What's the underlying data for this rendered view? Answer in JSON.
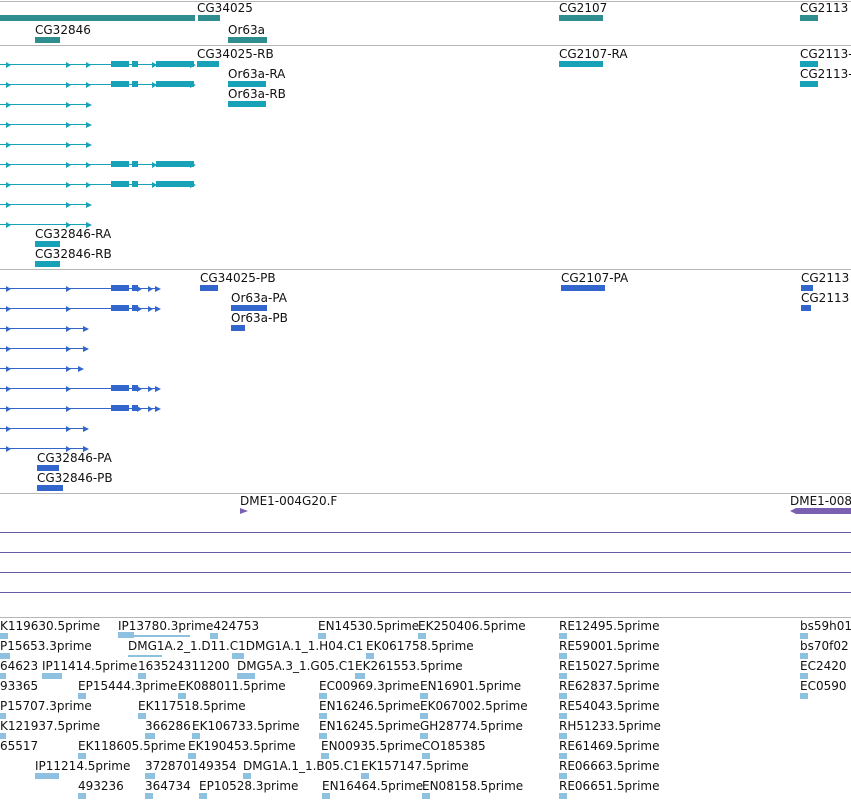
{
  "tracks": {
    "genes": {
      "labels": [
        "CG34025",
        "CG32846",
        "Or63a",
        "CG2107",
        "CG2113"
      ]
    },
    "transcripts": {
      "labels": [
        "CG34025-RB",
        "Or63a-RA",
        "Or63a-RB",
        "CG2107-RA",
        "CG2113-",
        "CG2113-",
        "CG32846-RA",
        "CG32846-RB"
      ]
    },
    "proteins": {
      "labels": [
        "CG34025-PB",
        "Or63a-PA",
        "Or63a-PB",
        "CG2107-PA",
        "CG2113",
        "CG2113",
        "CG32846-PA",
        "CG32846-PB"
      ]
    },
    "pcr_products": {
      "labels": [
        "DME1-004G20.F",
        "DME1-008"
      ]
    },
    "ests": {
      "rows": [
        [
          "K119630.5prime",
          "IP13780.3prime424753",
          "EN14530.5prime",
          "EK250406.5prime",
          "RE12495.5prime",
          "bs59h01"
        ],
        [
          "P15653.3prime",
          "DMG1A.2_1.D11.C1DMG1A.1_1.H04.C1",
          "EK061758.5prime",
          "RE59001.5prime",
          "bs70f02"
        ],
        [
          "64623",
          "IP11414.5prime",
          "163524311200",
          "DMG5A.3_1.G05.C1",
          "EK261553.5prime",
          "RE15027.5prime",
          "EC2420"
        ],
        [
          "93365",
          "EP15444.3prime",
          "EK088011.5prime",
          "EC00969.3prime",
          "EN16901.5prime",
          "RE62837.5prime",
          "EC0590"
        ],
        [
          "P15707.3prime",
          "EK117518.5prime",
          "EN16246.5prime",
          "EK067002.5prime",
          "RE54043.5prime"
        ],
        [
          "K121937.5prime",
          "366286",
          "EK106733.5prime",
          "EN16245.5prime",
          "GH28774.5prime",
          "RH51233.5prime"
        ],
        [
          "65517",
          "EK118605.5prime",
          "EK190453.5prime",
          "EN00935.5prime",
          "CO185385",
          "RE61469.5prime"
        ],
        [
          "IP11214.5prime",
          "372870149354",
          "DMG1A.1_1.B05.C1",
          "EK157147.5prime",
          "RE06663.5prime"
        ],
        [
          "493236",
          "364734",
          "EP10528.3prime",
          "EN16464.5prime",
          "EN08158.5prime",
          "RE06651.5prime"
        ]
      ]
    }
  },
  "colors": {
    "gene": "#2f8d8f",
    "transcript": "#17a2b8",
    "protein": "#3366cc",
    "pcr": "#7b5fb0",
    "est": "#8ec0df"
  }
}
